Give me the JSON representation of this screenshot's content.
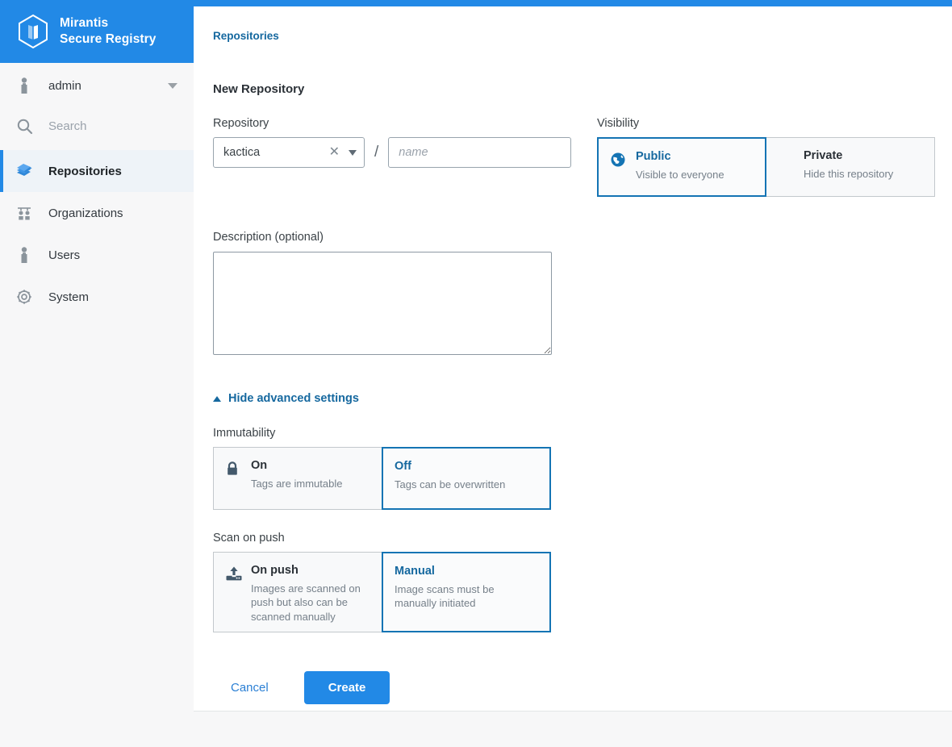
{
  "brand": {
    "line1": "Mirantis",
    "line2": "Secure Registry",
    "logo_icon": "hexagon-book-logo-icon"
  },
  "sidebar": {
    "user": {
      "name": "admin",
      "icon": "person-icon",
      "caret": "chevron-down-icon"
    },
    "search": {
      "placeholder": "Search",
      "value": "",
      "icon": "search-icon"
    },
    "items": [
      {
        "label": "Repositories",
        "icon": "books-icon",
        "active": true
      },
      {
        "label": "Organizations",
        "icon": "people-icon",
        "active": false
      },
      {
        "label": "Users",
        "icon": "person-icon",
        "active": false
      },
      {
        "label": "System",
        "icon": "gear-icon",
        "active": false
      }
    ]
  },
  "main": {
    "breadcrumb": "Repositories",
    "page_title": "New Repository",
    "repository": {
      "label": "Repository",
      "namespace_value": "kactica",
      "namespace_clear_icon": "close-icon",
      "namespace_caret_icon": "chevron-down-icon",
      "separator": "/",
      "name_placeholder": "name",
      "name_value": ""
    },
    "description": {
      "label": "Description",
      "optional": "(optional)",
      "value": "",
      "placeholder": ""
    },
    "visibility": {
      "label": "Visibility",
      "options": [
        {
          "title": "Public",
          "desc": "Visible to everyone",
          "icon": "globe-icon",
          "selected": true
        },
        {
          "title": "Private",
          "desc": "Hide this repository",
          "icon": "",
          "selected": false
        }
      ]
    },
    "advanced_toggle": {
      "label": "Hide advanced settings",
      "icon": "chevron-up-icon"
    },
    "immutability": {
      "label": "Immutability",
      "options": [
        {
          "title": "On",
          "desc": "Tags are immutable",
          "icon": "lock-icon",
          "selected": false
        },
        {
          "title": "Off",
          "desc": "Tags can be overwritten",
          "icon": "",
          "selected": true
        }
      ]
    },
    "scan_on_push": {
      "label": "Scan on push",
      "options": [
        {
          "title": "On push",
          "desc": "Images are scanned on push but also can be scanned manually",
          "icon": "upload-server-icon",
          "selected": false
        },
        {
          "title": "Manual",
          "desc": "Image scans must be manually initiated",
          "icon": "",
          "selected": true
        }
      ]
    },
    "actions": {
      "cancel_label": "Cancel",
      "create_label": "Create"
    }
  },
  "colors": {
    "brand_blue": "#2289e6",
    "link_blue": "#15689f",
    "selected_border": "#1474b4",
    "sidebar_bg": "#f7f7f8",
    "icon_gray": "#8b949c",
    "icon_slate": "#43596b"
  }
}
